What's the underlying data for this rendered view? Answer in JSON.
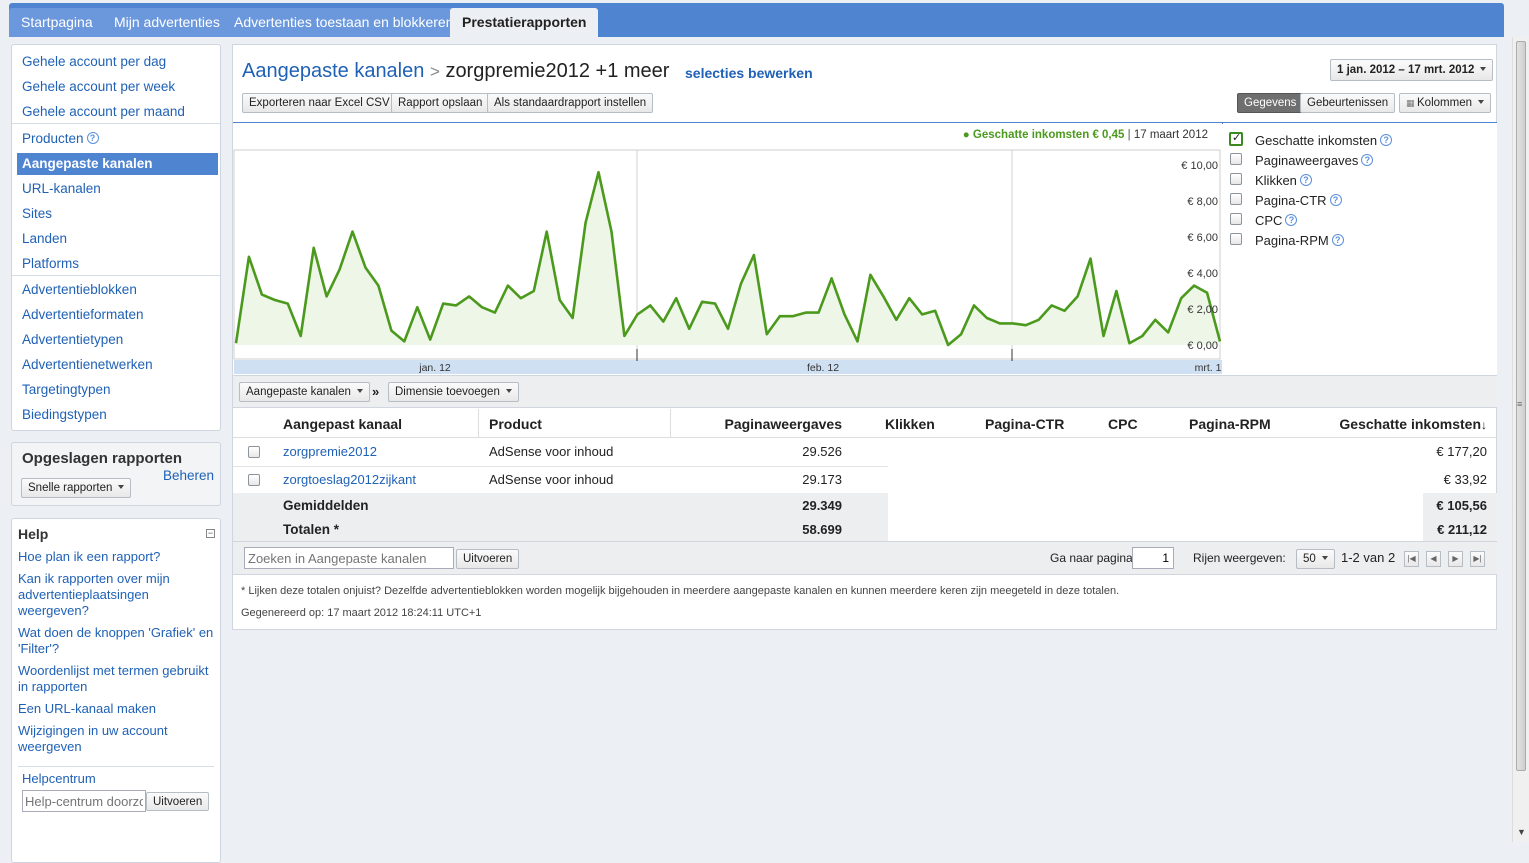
{
  "tabs": [
    "Startpagina",
    "Mijn advertenties",
    "Advertenties toestaan en blokkeren",
    "Prestatierapporten"
  ],
  "nav": {
    "group1": [
      "Gehele account per dag",
      "Gehele account per week",
      "Gehele account per maand"
    ],
    "group2": [
      "Producten",
      "Aangepaste kanalen",
      "URL-kanalen",
      "Sites",
      "Landen",
      "Platforms"
    ],
    "group3": [
      "Advertentieblokken",
      "Advertentieformaten",
      "Advertentietypen",
      "Advertentienetwerken",
      "Targetingtypen",
      "Biedingstypen"
    ]
  },
  "saved": {
    "title": "Opgeslagen rapporten",
    "quick": "Snelle rapporten",
    "manage": "Beheren"
  },
  "help": {
    "title": "Help",
    "links": [
      "Hoe plan ik een rapport?",
      "Kan ik rapporten over mijn advertentieplaatsingen weergeven?",
      "Wat doen de knoppen 'Grafiek' en 'Filter'?",
      "Woordenlijst met termen gebruikt in rapporten",
      "Een URL-kanaal maken",
      "Wijzigingen in uw account weergeven"
    ],
    "center": "Helpcentrum",
    "placeholder": "Help-centrum doorzo",
    "go": "Uitvoeren"
  },
  "header": {
    "crumb": "Aangepaste kanalen",
    "sep": ">",
    "current": "zorgpremie2012 +1 meer",
    "edit": "selecties bewerken",
    "daterange": "1 jan. 2012 – 17 mrt. 2012"
  },
  "actions": {
    "export": "Exporteren naar Excel CSV",
    "save": "Rapport opslaan",
    "default": "Als standaardrapport instellen",
    "data": "Gegevens",
    "events": "Gebeurtenissen",
    "columns": "Kolommen"
  },
  "tooltip": {
    "metric": "Geschatte inkomsten",
    "value": "€ 0,45",
    "sep": "|",
    "date": "17 maart 2012"
  },
  "metrics": [
    {
      "label": "Geschatte inkomsten",
      "checked": true
    },
    {
      "label": "Paginaweergaves",
      "checked": false
    },
    {
      "label": "Klikken",
      "checked": false
    },
    {
      "label": "Pagina-CTR",
      "checked": false
    },
    {
      "label": "CPC",
      "checked": false
    },
    {
      "label": "Pagina-RPM",
      "checked": false
    }
  ],
  "chart_data": {
    "type": "area",
    "series": [
      {
        "name": "Geschatte inkomsten",
        "values": [
          0.1,
          4.9,
          2.8,
          2.5,
          2.3,
          0.5,
          5.4,
          2.7,
          4.2,
          6.3,
          4.3,
          3.3,
          0.8,
          0.2,
          2.1,
          0.3,
          2.3,
          2.2,
          2.7,
          2.1,
          1.8,
          3.3,
          2.6,
          3.0,
          6.3,
          2.5,
          1.5,
          6.8,
          9.6,
          6.3,
          0.5,
          1.7,
          2.2,
          1.3,
          2.6,
          0.9,
          2.4,
          2.3,
          0.9,
          3.4,
          5.0,
          0.6,
          1.6,
          1.6,
          1.8,
          1.8,
          3.7,
          1.7,
          0.2,
          3.9,
          2.7,
          1.4,
          2.6,
          1.7,
          1.9,
          0.0,
          0.6,
          2.2,
          1.5,
          1.2,
          1.2,
          1.1,
          1.4,
          2.2,
          1.9,
          2.7,
          4.8,
          0.5,
          3.0,
          0.1,
          0.5,
          1.4,
          0.7,
          2.6,
          3.3,
          2.9,
          0.2
        ]
      }
    ],
    "yticks": [
      "€ 10,00",
      "€ 8,00",
      "€ 6,00",
      "€ 4,00",
      "€ 2,00",
      "€ 0,00"
    ],
    "xticks": [
      "jan. 12",
      "feb. 12",
      "mrt. 1"
    ],
    "ylim": [
      0,
      10
    ],
    "grid": true
  },
  "breakdown": {
    "dim": "Aangepaste kanalen",
    "arrow": "»",
    "add": "Dimensie toevoegen"
  },
  "table": {
    "headers": [
      "Aangepast kanaal",
      "Product",
      "Paginaweergaves",
      "Klikken",
      "Pagina-CTR",
      "CPC",
      "Pagina-RPM",
      "Geschatte inkomsten"
    ],
    "sort_icon": "↓",
    "rows": [
      {
        "channel": "zorgpremie2012",
        "product": "AdSense voor inhoud",
        "views": "29.526",
        "earnings": "€ 177,20"
      },
      {
        "channel": "zorgtoeslag2012zijkant",
        "product": "AdSense voor inhoud",
        "views": "29.173",
        "earnings": "€ 33,92"
      }
    ],
    "avg": {
      "label": "Gemiddelden",
      "views": "29.349",
      "earnings": "€ 105,56"
    },
    "total": {
      "label": "Totalen *",
      "views": "58.699",
      "earnings": "€ 211,12"
    }
  },
  "pager": {
    "search_placeholder": "Zoeken in Aangepaste kanalen",
    "go": "Uitvoeren",
    "goto": "Ga naar pagina:",
    "page": "1",
    "rows_label": "Rijen weergeven:",
    "rows": "50",
    "range": "1-2 van 2"
  },
  "footnote": "* Lijken deze totalen onjuist? Dezelfde advertentieblokken worden mogelijk bijgehouden in meerdere aangepaste kanalen en kunnen meerdere keren zijn meegeteld in deze totalen.",
  "generated": "Gegenereerd op: 17 maart 2012 18:24:11 UTC+1",
  "colors": {
    "accent": "#4f84d1",
    "series": "#4c9a1d",
    "fill": "#eef6e8"
  }
}
